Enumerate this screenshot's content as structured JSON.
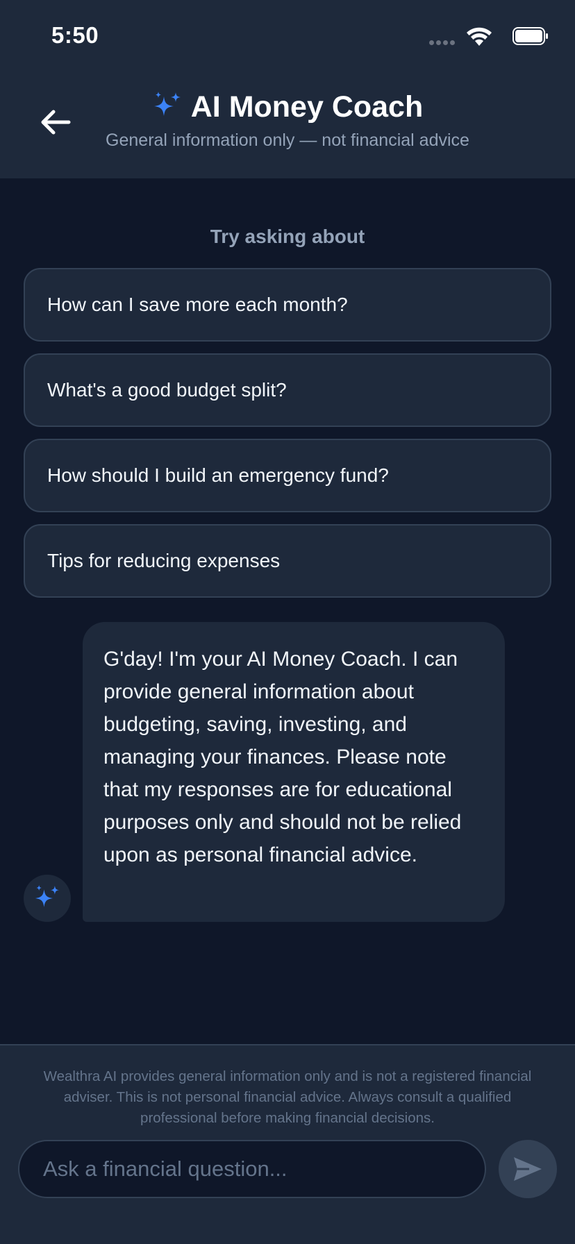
{
  "status_bar": {
    "time": "5:50"
  },
  "header": {
    "title": "AI Money Coach",
    "subtitle": "General information only — not financial advice",
    "accent_color": "#3b82f6"
  },
  "suggestions": {
    "heading": "Try asking about",
    "items": [
      "How can I save more each month?",
      "What's a good budget split?",
      "How should I build an emergency fund?",
      "Tips for reducing expenses"
    ]
  },
  "messages": [
    {
      "sender": "assistant",
      "text": "G'day! I'm your AI Money Coach. I can provide general information about budgeting, saving, investing, and managing your finances. Please note that my responses are for educational purposes only and should not be relied upon as personal financial advice."
    }
  ],
  "footer": {
    "disclaimer": "Wealthra AI provides general information only and is not a registered financial adviser. This is not personal financial advice. Always consult a qualified professional before making financial decisions.",
    "input_placeholder": "Ask a financial question...",
    "input_value": ""
  },
  "icons": {
    "back": "arrow-left-icon",
    "sparkle": "sparkles-icon",
    "send": "send-icon"
  }
}
